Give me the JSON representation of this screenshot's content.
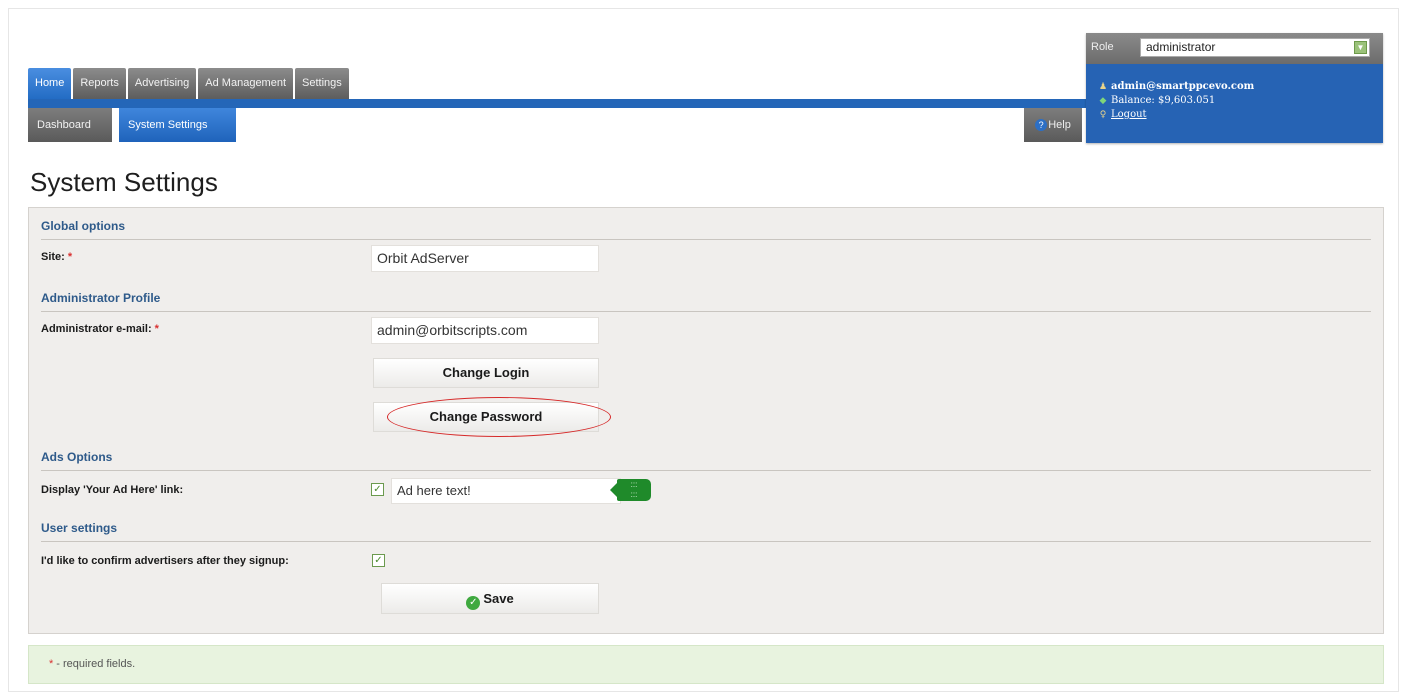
{
  "nav": {
    "tabs": [
      {
        "label": "Home",
        "active": true
      },
      {
        "label": "Reports",
        "active": false
      },
      {
        "label": "Advertising",
        "active": false
      },
      {
        "label": "Ad Management",
        "active": false
      },
      {
        "label": "Settings",
        "active": false
      }
    ],
    "subtabs": [
      {
        "label": "Dashboard",
        "active": false
      },
      {
        "label": "System Settings",
        "active": true
      }
    ],
    "help_label": "Help"
  },
  "user": {
    "role_label": "Role",
    "role_value": "administrator",
    "email": "admin@smartppcevo.com",
    "balance": "Balance: $9,603.051",
    "logout": "Logout"
  },
  "page": {
    "title": "System Settings"
  },
  "form": {
    "global_options": "Global options",
    "site_label": "Site:",
    "site_value": "Orbit AdServer",
    "admin_profile": "Administrator Profile",
    "admin_email_label": "Administrator e-mail:",
    "admin_email_value": "admin@orbitscripts.com",
    "change_login": "Change Login",
    "change_password": "Change Password",
    "ads_options": "Ads Options",
    "display_link_label": "Display 'Your Ad Here' link:",
    "display_link_checked": true,
    "ad_here_text": "Ad here text!",
    "user_settings": "User settings",
    "confirm_label": "I'd like to confirm advertisers after they signup:",
    "confirm_checked": true,
    "save": "Save",
    "required_star": "*"
  },
  "footer": {
    "note": "- required fields."
  },
  "colors": {
    "nav_active": "#236cc4",
    "nav_inactive": "#5d5d5d",
    "section_heading": "#2e5a8a",
    "required": "#d93030",
    "highlight_ellipse": "#d62a2a",
    "note_bg": "#e8f3df"
  },
  "icons": {
    "help": "help-circle-icon",
    "user": "user-icon",
    "balance": "money-icon",
    "logout": "key-icon",
    "save": "check-circle-icon",
    "checkbox": "checkbox-checked-icon",
    "dropdown": "chevron-down-icon",
    "tag": "color-tag-icon"
  }
}
